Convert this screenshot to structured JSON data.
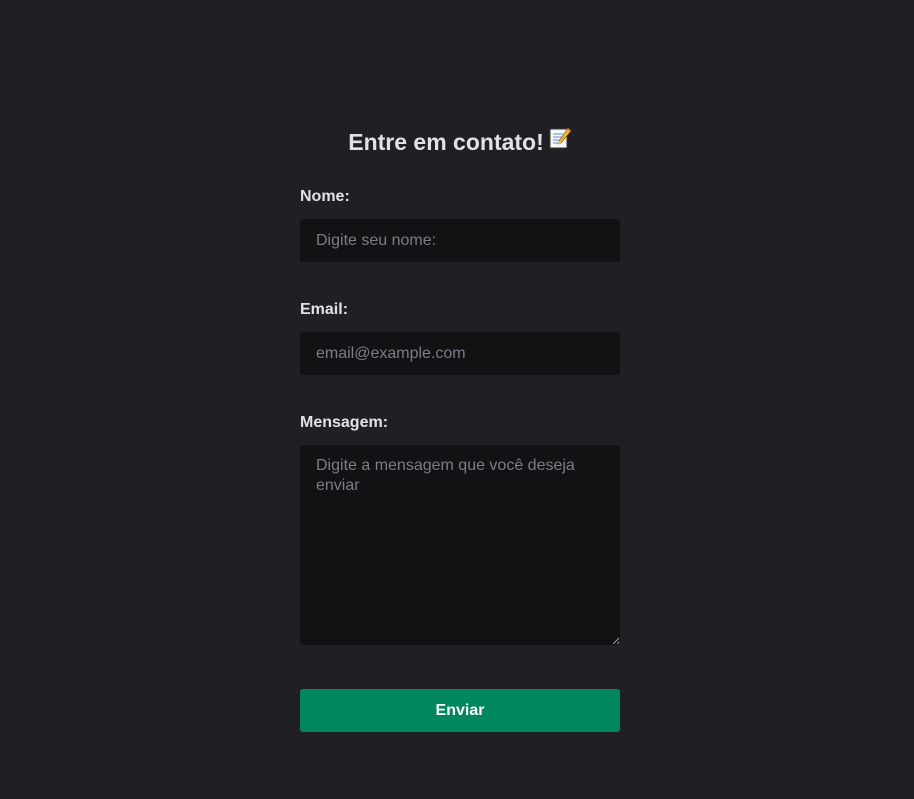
{
  "form": {
    "title": "Entre em contato!",
    "title_icon": "memo-icon",
    "fields": {
      "name": {
        "label": "Nome:",
        "placeholder": "Digite seu nome:",
        "value": ""
      },
      "email": {
        "label": "Email:",
        "placeholder": "email@example.com",
        "value": ""
      },
      "message": {
        "label": "Mensagem:",
        "placeholder": "Digite a mensagem que você deseja enviar",
        "value": ""
      }
    },
    "submit_label": "Enviar"
  },
  "colors": {
    "background": "#202024",
    "input_background": "#121214",
    "text": "#e1e1e6",
    "placeholder": "#7c7c8a",
    "button": "#00875f"
  }
}
